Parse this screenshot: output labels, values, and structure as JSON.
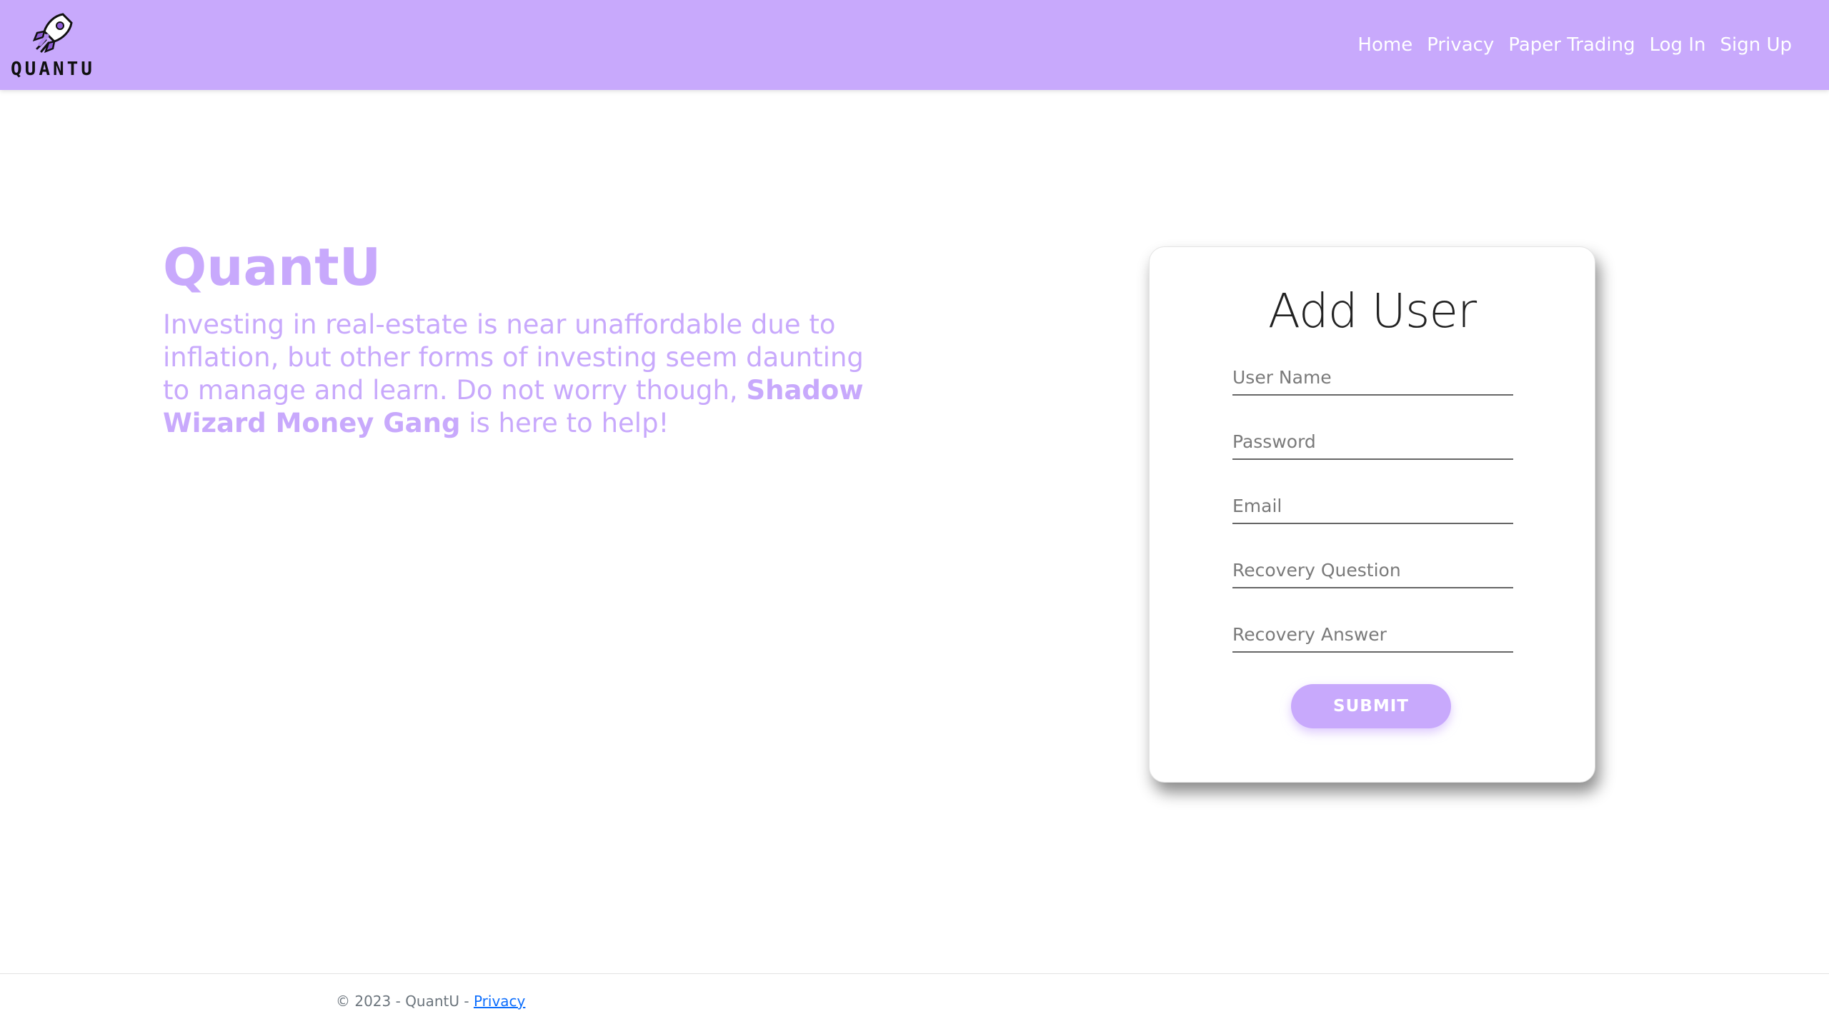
{
  "brand": {
    "logo_icon": "rocket-icon",
    "logo_text": "QUANTU"
  },
  "nav": {
    "items": [
      {
        "label": "Home"
      },
      {
        "label": "Privacy"
      },
      {
        "label": "Paper Trading"
      },
      {
        "label": "Log In"
      },
      {
        "label": "Sign Up"
      }
    ]
  },
  "hero": {
    "title": "QuantU",
    "text_before": "Investing in real-estate is near unaffordable due to inflation, but other forms of investing seem daunting to manage and learn. Do not worry though, ",
    "text_bold": "Shadow Wizard Money Gang",
    "text_after": " is here to help!"
  },
  "form": {
    "title": "Add User",
    "fields": [
      {
        "placeholder": "User Name",
        "value": ""
      },
      {
        "placeholder": "Password",
        "value": ""
      },
      {
        "placeholder": "Email",
        "value": ""
      },
      {
        "placeholder": "Recovery Question",
        "value": ""
      },
      {
        "placeholder": "Recovery Answer",
        "value": ""
      }
    ],
    "submit_label": "SUBMIT"
  },
  "footer": {
    "copyright": "© 2023 - QuantU - ",
    "privacy_link": "Privacy"
  },
  "colors": {
    "accent": "#c8a9fc",
    "link": "#0d6efd",
    "footer_text": "#6c757d"
  }
}
